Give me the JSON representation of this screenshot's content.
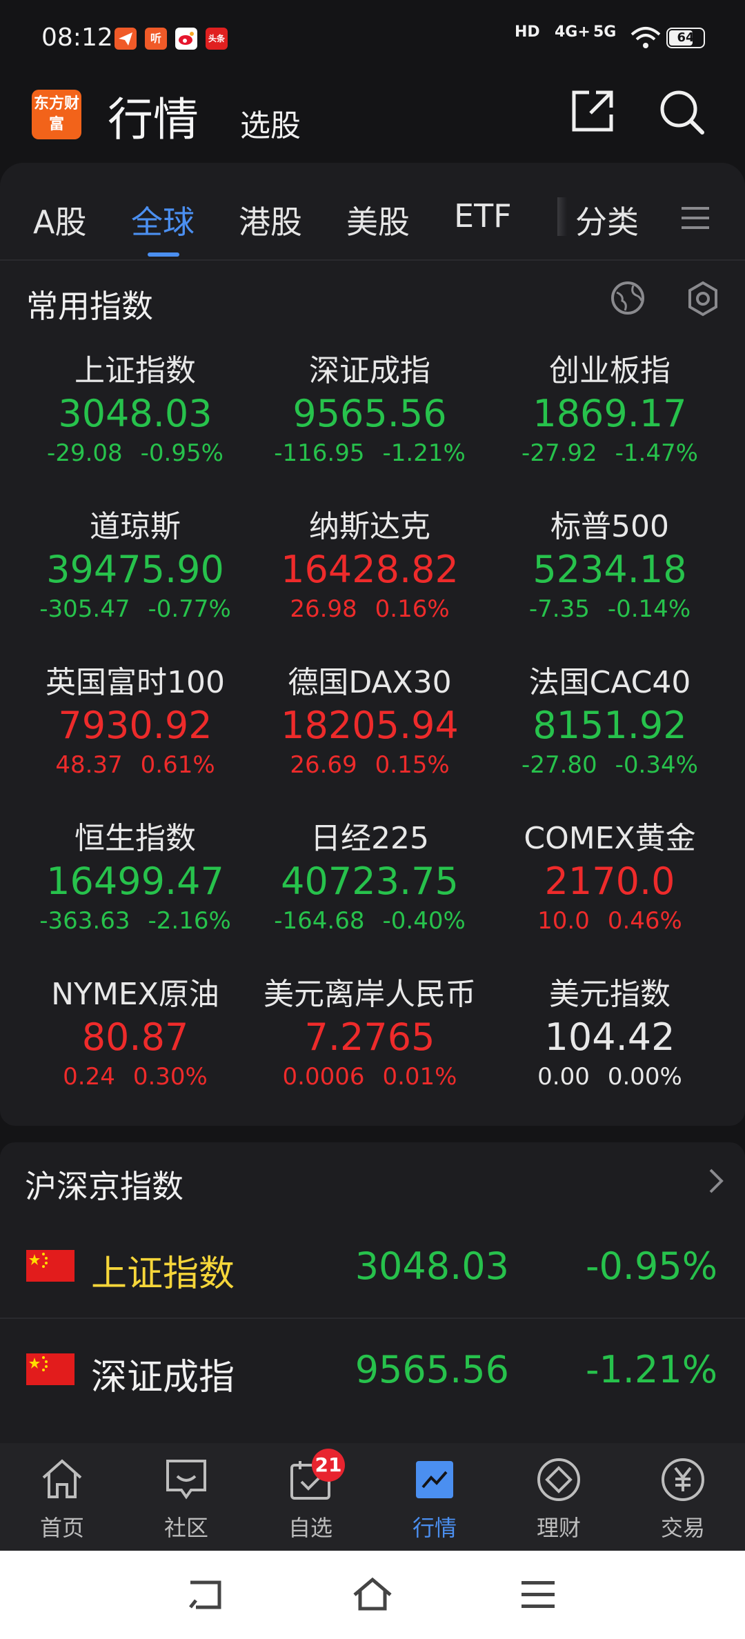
{
  "status_bar": {
    "time": "08:12",
    "app_icons": [
      {
        "icon": "send-icon",
        "color": "#f05a28"
      },
      {
        "icon": "listen-icon",
        "color": "#f05a28",
        "text": "听"
      },
      {
        "icon": "weibo-icon",
        "color": "#ffffff"
      },
      {
        "icon": "toutiao-icon",
        "color": "#e02020",
        "text": "头条"
      }
    ],
    "hd": "HD",
    "net1": "4G+",
    "net2": "5G",
    "battery": "64"
  },
  "header": {
    "logo_text": "东方财富",
    "title": "行情",
    "subtitle": "选股"
  },
  "tabs": [
    {
      "label": "A股"
    },
    {
      "label": "全球"
    },
    {
      "label": "港股"
    },
    {
      "label": "美股"
    },
    {
      "label": "ETF"
    },
    {
      "label": "分类"
    }
  ],
  "common": {
    "title": "常用指数",
    "indices": [
      {
        "name": "上证指数",
        "price": "3048.03",
        "change": "-29.08",
        "pct": "-0.95%",
        "trend": "down"
      },
      {
        "name": "深证成指",
        "price": "9565.56",
        "change": "-116.95",
        "pct": "-1.21%",
        "trend": "down"
      },
      {
        "name": "创业板指",
        "price": "1869.17",
        "change": "-27.92",
        "pct": "-1.47%",
        "trend": "down"
      },
      {
        "name": "道琼斯",
        "price": "39475.90",
        "change": "-305.47",
        "pct": "-0.77%",
        "trend": "down"
      },
      {
        "name": "纳斯达克",
        "price": "16428.82",
        "change": "26.98",
        "pct": "0.16%",
        "trend": "up"
      },
      {
        "name": "标普500",
        "price": "5234.18",
        "change": "-7.35",
        "pct": "-0.14%",
        "trend": "down"
      },
      {
        "name": "英国富时100",
        "price": "7930.92",
        "change": "48.37",
        "pct": "0.61%",
        "trend": "up"
      },
      {
        "name": "德国DAX30",
        "price": "18205.94",
        "change": "26.69",
        "pct": "0.15%",
        "trend": "up"
      },
      {
        "name": "法国CAC40",
        "price": "8151.92",
        "change": "-27.80",
        "pct": "-0.34%",
        "trend": "down"
      },
      {
        "name": "恒生指数",
        "price": "16499.47",
        "change": "-363.63",
        "pct": "-2.16%",
        "trend": "down"
      },
      {
        "name": "日经225",
        "price": "40723.75",
        "change": "-164.68",
        "pct": "-0.40%",
        "trend": "down"
      },
      {
        "name": "COMEX黄金",
        "price": "2170.0",
        "change": "10.0",
        "pct": "0.46%",
        "trend": "up"
      },
      {
        "name": "NYMEX原油",
        "price": "80.87",
        "change": "0.24",
        "pct": "0.30%",
        "trend": "up"
      },
      {
        "name": "美元离岸人民币",
        "price": "7.2765",
        "change": "0.0006",
        "pct": "0.01%",
        "trend": "up"
      },
      {
        "name": "美元指数",
        "price": "104.42",
        "change": "0.00",
        "pct": "0.00%",
        "trend": "flat"
      }
    ]
  },
  "hs_index": {
    "title": "沪深京指数",
    "rows": [
      {
        "name": "上证指数",
        "price": "3048.03",
        "pct": "-0.95%"
      },
      {
        "name": "深证成指",
        "price": "9565.56",
        "pct": "-1.21%"
      }
    ]
  },
  "bottom_nav": {
    "items": [
      {
        "label": "首页",
        "icon": "home-icon"
      },
      {
        "label": "社区",
        "icon": "community-icon"
      },
      {
        "label": "自选",
        "icon": "watchlist-icon"
      },
      {
        "label": "行情",
        "icon": "market-icon"
      },
      {
        "label": "理财",
        "icon": "wealth-icon"
      },
      {
        "label": "交易",
        "icon": "trade-icon"
      }
    ],
    "badge": "21"
  },
  "colors": {
    "up": "#ee2b2b",
    "down": "#27c24c",
    "flat": "#e8e8e8",
    "accent": "#4b8ff0",
    "highlight_name": "#f6d63a"
  }
}
